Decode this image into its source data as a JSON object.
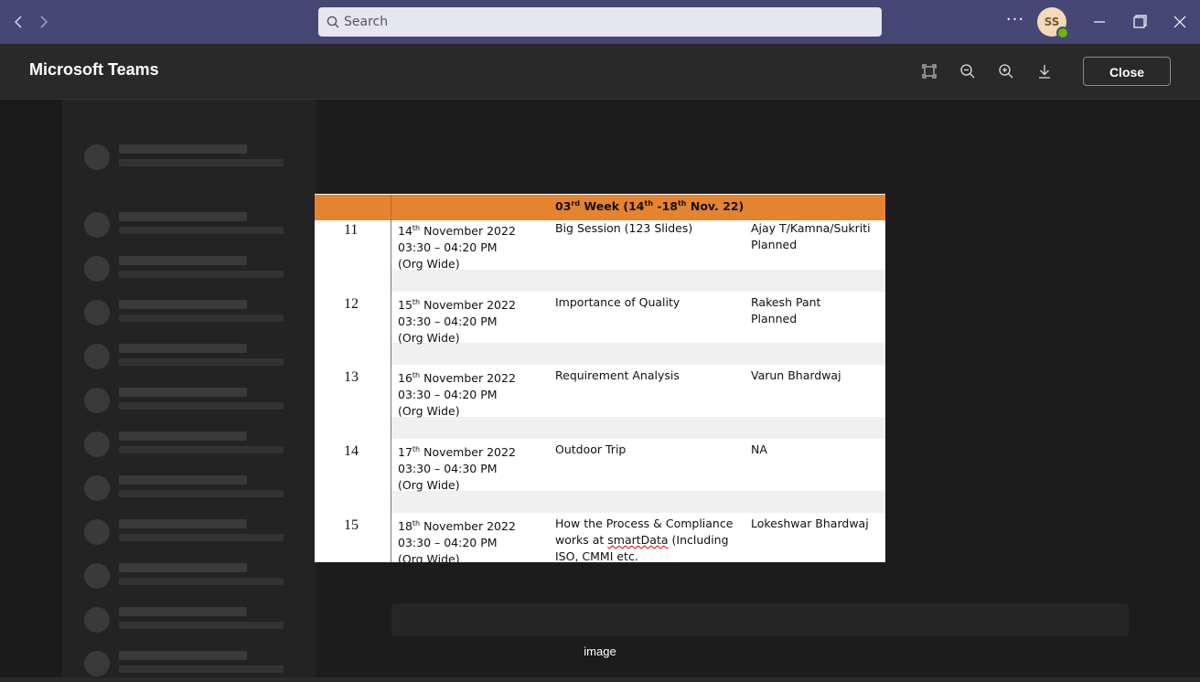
{
  "titlebar": {
    "back_label": "‹",
    "forward_label": "›",
    "search_placeholder": "Search",
    "more_label": "···",
    "avatar_initials": "SS"
  },
  "viewer": {
    "app_title": "Microsoft Teams",
    "close_label": "Close",
    "caption": "image"
  },
  "document": {
    "week_header": {
      "prefix": "03",
      "prefix_sup": "rd",
      "mid1": " Week (14",
      "sup1": "th",
      "mid2": " -18",
      "sup2": "th",
      "suffix": " Nov. 22)"
    },
    "rows": [
      {
        "num": "11",
        "day": "14",
        "sup": "th",
        "date_rest": " November 2022",
        "time": "03:30 – 04:20 PM",
        "scope": "(Org Wide)",
        "topic": "Big Session (123 Slides)",
        "owner": "Ajay T/Kamna/Sukriti",
        "status": "Planned"
      },
      {
        "num": "12",
        "day": "15",
        "sup": "th",
        "date_rest": " November 2022",
        "time": "03:30 – 04:20 PM",
        "scope": "(Org Wide)",
        "topic": "Importance of Quality",
        "owner": "Rakesh Pant",
        "status": "Planned"
      },
      {
        "num": "13",
        "day": "16",
        "sup": "th",
        "date_rest": " November 2022",
        "time": "03:30 – 04:20 PM",
        "scope": "(Org Wide)",
        "topic": "Requirement Analysis",
        "owner": "Varun Bhardwaj",
        "status": ""
      },
      {
        "num": "14",
        "day": "17",
        "sup": "th",
        "date_rest": " November 2022",
        "time": "03:30 – 04:30 PM",
        "scope": "(Org Wide)",
        "topic": "Outdoor Trip",
        "owner": "NA",
        "status": ""
      },
      {
        "num": "15",
        "day": "18",
        "sup": "th",
        "date_rest": " November 2022",
        "time": "03:30 – 04:20 PM",
        "scope": "(Org Wide)",
        "topic_l1": "How the Process & Compliance",
        "topic_l2a": "works at ",
        "topic_l2b": "smartData",
        "topic_l2c": " (Including",
        "topic_l3": "ISO, CMMI etc.",
        "owner": "Lokeshwar Bhardwaj",
        "status": ""
      }
    ]
  }
}
